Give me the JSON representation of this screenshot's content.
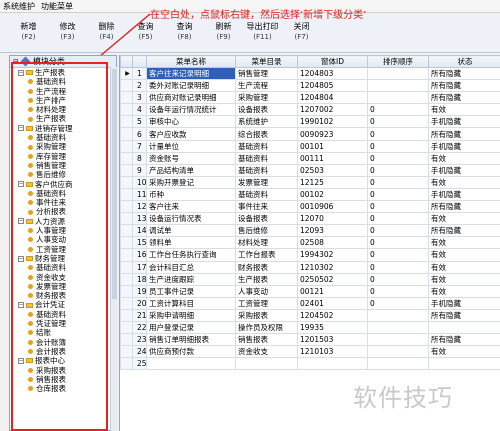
{
  "menubar": {
    "items": [
      "系统维护",
      "功能菜单"
    ]
  },
  "toolbar": {
    "buttons": [
      {
        "label": "新增",
        "key": "(F2)"
      },
      {
        "label": "修改",
        "key": "(F3)"
      },
      {
        "label": "删除",
        "key": "(F4)"
      },
      {
        "label": "查询",
        "key": "(F5)"
      },
      {
        "label": "查询",
        "key": "(F8)"
      },
      {
        "label": "刷新",
        "key": "(F9)"
      },
      {
        "label": "导出打印",
        "key": "(F11)"
      },
      {
        "label": "关闭",
        "key": "(F7)"
      }
    ]
  },
  "annotation": "在空白处，点鼠标右键，然后选择‘新增下级分类’",
  "tree": {
    "root": "模块分类",
    "nodes": [
      {
        "level": 0,
        "label": "生产报表",
        "type": "folder"
      },
      {
        "level": 1,
        "label": "基础资料",
        "type": "leaf"
      },
      {
        "level": 1,
        "label": "生产流程",
        "type": "leaf"
      },
      {
        "level": 1,
        "label": "生产排产",
        "type": "leaf"
      },
      {
        "level": 1,
        "label": "材料处理",
        "type": "leaf"
      },
      {
        "level": 1,
        "label": "生产报表",
        "type": "leaf"
      },
      {
        "level": 0,
        "label": "进销存管理",
        "type": "folder"
      },
      {
        "level": 1,
        "label": "基础资料",
        "type": "leaf"
      },
      {
        "level": 1,
        "label": "采购管理",
        "type": "leaf"
      },
      {
        "level": 1,
        "label": "库存管理",
        "type": "leaf"
      },
      {
        "level": 1,
        "label": "销售管理",
        "type": "leaf"
      },
      {
        "level": 1,
        "label": "售后维修",
        "type": "leaf"
      },
      {
        "level": 0,
        "label": "客户供应商",
        "type": "folder"
      },
      {
        "level": 1,
        "label": "基础资料",
        "type": "leaf"
      },
      {
        "level": 1,
        "label": "事件往来",
        "type": "leaf"
      },
      {
        "level": 1,
        "label": "分析报表",
        "type": "leaf"
      },
      {
        "level": 0,
        "label": "人力资源",
        "type": "folder"
      },
      {
        "level": 1,
        "label": "人事管理",
        "type": "leaf"
      },
      {
        "level": 1,
        "label": "人事变动",
        "type": "leaf"
      },
      {
        "level": 1,
        "label": "工资管理",
        "type": "leaf"
      },
      {
        "level": 0,
        "label": "财务管理",
        "type": "folder"
      },
      {
        "level": 1,
        "label": "基础资料",
        "type": "leaf"
      },
      {
        "level": 1,
        "label": "资金收支",
        "type": "leaf"
      },
      {
        "level": 1,
        "label": "发票管理",
        "type": "leaf"
      },
      {
        "level": 1,
        "label": "财务报表",
        "type": "leaf"
      },
      {
        "level": 0,
        "label": "会计凭证",
        "type": "folder"
      },
      {
        "level": 1,
        "label": "基础资料",
        "type": "leaf"
      },
      {
        "level": 1,
        "label": "凭证管理",
        "type": "leaf"
      },
      {
        "level": 1,
        "label": "结账",
        "type": "leaf"
      },
      {
        "level": 1,
        "label": "会计账簿",
        "type": "leaf"
      },
      {
        "level": 1,
        "label": "会计报表",
        "type": "leaf"
      },
      {
        "level": 0,
        "label": "报表中心",
        "type": "folder"
      },
      {
        "level": 1,
        "label": "采购报表",
        "type": "leaf"
      },
      {
        "level": 1,
        "label": "销售报表",
        "type": "leaf"
      },
      {
        "level": 1,
        "label": "仓库报表",
        "type": "leaf"
      }
    ]
  },
  "grid": {
    "columns": [
      "",
      "",
      "菜单名称",
      "菜单目录",
      "窗体ID",
      "排序顺序",
      "状态"
    ],
    "rows": [
      [
        "客户往来记录明细",
        "销售管理",
        "1204803",
        "",
        "所有隐藏"
      ],
      [
        "委外对账记录明细",
        "生产流程",
        "1204805",
        "",
        "所有隐藏"
      ],
      [
        "供应商对账记录明细",
        "采购管理",
        "1204804",
        "",
        "所有隐藏"
      ],
      [
        "设备年运行情况统计",
        "设备报表",
        "1207002",
        "0",
        "有效"
      ],
      [
        "审核中心",
        "系统维护",
        "1990102",
        "0",
        "手机隐藏"
      ],
      [
        "客户应收款",
        "综合报表",
        "0090923",
        "0",
        "所有隐藏"
      ],
      [
        "计量单位",
        "基础资料",
        "00101",
        "0",
        "手机隐藏"
      ],
      [
        "资金账号",
        "基础资料",
        "00111",
        "0",
        "有效"
      ],
      [
        "产品结构清单",
        "基础资料",
        "02503",
        "0",
        "手机隐藏"
      ],
      [
        "采购开票登记",
        "发票管理",
        "12125",
        "0",
        "有效"
      ],
      [
        "币种",
        "基础资料",
        "00102",
        "0",
        "手机隐藏"
      ],
      [
        "客户往来",
        "事件往来",
        "0010906",
        "0",
        "所有隐藏"
      ],
      [
        "设备运行情况表",
        "设备报表",
        "12070",
        "0",
        "有效"
      ],
      [
        "调试单",
        "售后维修",
        "12093",
        "0",
        "所有隐藏"
      ],
      [
        "领料单",
        "材料处理",
        "02508",
        "0",
        "有效"
      ],
      [
        "工作台任务执行查询",
        "工作台报表",
        "1994302",
        "0",
        "有效"
      ],
      [
        "会计科目汇总",
        "财务报表",
        "1210302",
        "0",
        "有效"
      ],
      [
        "生产进度跟踪",
        "生产报表",
        "0250502",
        "0",
        "有效"
      ],
      [
        "员工事件记录",
        "人事变动",
        "00121",
        "0",
        "有效"
      ],
      [
        "工资计算科目",
        "工资管理",
        "02401",
        "0",
        "手机隐藏"
      ],
      [
        "采购申请明细",
        "采购报表",
        "1204502",
        "",
        "所有隐藏"
      ],
      [
        "用户登录记录",
        "操作员及权限",
        "19935",
        "",
        ""
      ],
      [
        "销售订单明细报表",
        "销售报表",
        "1201503",
        "",
        "所有隐藏"
      ],
      [
        "供应商预付款",
        "资金收支",
        "1210103",
        "",
        "有效"
      ],
      [
        "",
        "",
        "",
        "",
        ""
      ]
    ]
  },
  "watermark": "软件技巧"
}
